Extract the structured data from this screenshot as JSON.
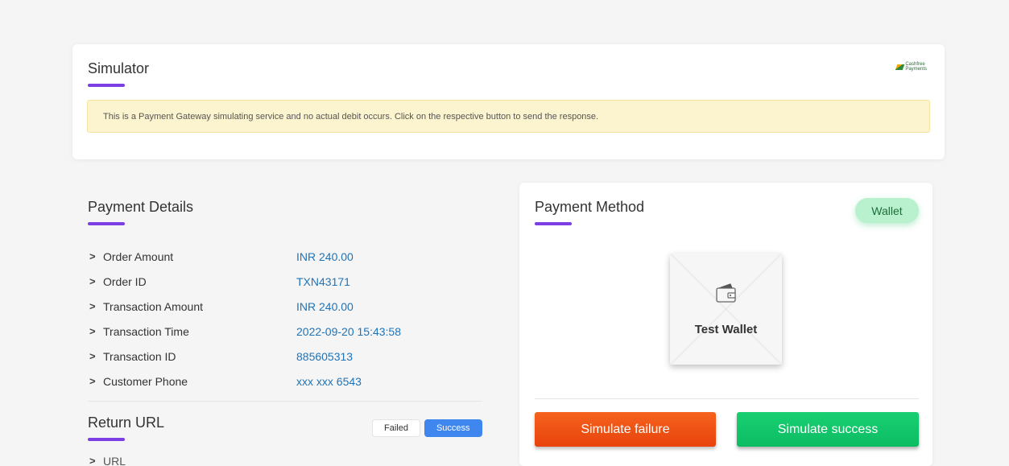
{
  "simulator": {
    "title": "Simulator",
    "brand_logo_text": [
      "Cashfree",
      "Payments"
    ],
    "notice": "This is a Payment Gateway simulating service and no actual debit occurs. Click on the respective button to send the response."
  },
  "payment_details": {
    "title": "Payment Details",
    "rows": [
      {
        "label": "Order Amount",
        "value": "INR 240.00"
      },
      {
        "label": "Order ID",
        "value": "TXN43171"
      },
      {
        "label": "Transaction Amount",
        "value": "INR 240.00"
      },
      {
        "label": "Transaction Time",
        "value": "2022-09-20 15:43:58"
      },
      {
        "label": "Transaction ID",
        "value": "885605313"
      },
      {
        "label": "Customer Phone",
        "value": "xxx xxx 6543"
      }
    ],
    "return_url": {
      "title": "Return URL",
      "toggle": {
        "failed": "Failed",
        "success": "Success",
        "selected": "Success"
      },
      "url_label": "URL"
    }
  },
  "payment_method": {
    "title": "Payment Method",
    "badge": "Wallet",
    "wallet_name": "Test Wallet",
    "simulate_failure": "Simulate failure",
    "simulate_success": "Simulate success"
  },
  "colors": {
    "accent_underline": "#7b3fe4",
    "value_blue": "#1f73b7",
    "failure_orange": "#f15a1a",
    "success_green": "#12c66b",
    "toggle_active": "#3f86ef"
  }
}
